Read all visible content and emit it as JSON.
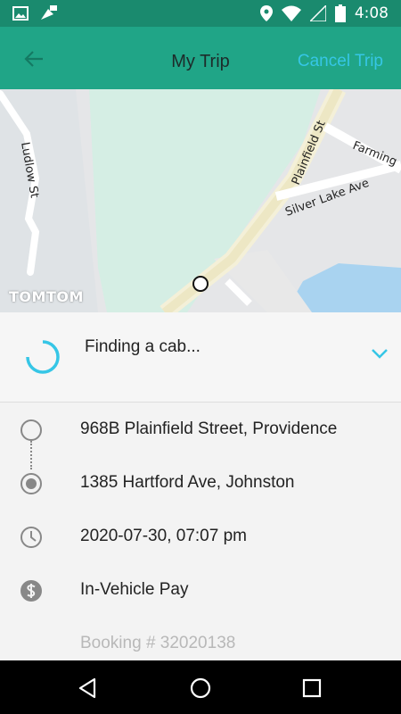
{
  "status_bar": {
    "time": "4:08",
    "icons": [
      "image-icon",
      "fake-gps-icon",
      "location-icon",
      "wifi-icon",
      "signal-icon",
      "battery-icon"
    ]
  },
  "app_bar": {
    "back_icon": "arrow-left-icon",
    "title": "My Trip",
    "cancel_label": "Cancel Trip"
  },
  "map": {
    "provider": "TOMTOM",
    "roads": [
      "Ludlow St",
      "Plainfield St",
      "Silver Lake Ave",
      "Farming"
    ]
  },
  "trip_status": {
    "text": "Finding a cab...",
    "spinner_icon": "loading-spinner-icon",
    "expand_icon": "chevron-down-icon"
  },
  "details": {
    "pickup": "968B Plainfield Street, Providence",
    "dropoff": "1385 Hartford Ave, Johnston",
    "datetime": "2020-07-30, 07:07 pm",
    "payment": "In-Vehicle Pay",
    "booking": "Booking # 32020138"
  },
  "colors": {
    "status_bar": "#1a8a6e",
    "app_bar": "#20a587",
    "accent": "#36c6e6",
    "text": "#222222"
  }
}
